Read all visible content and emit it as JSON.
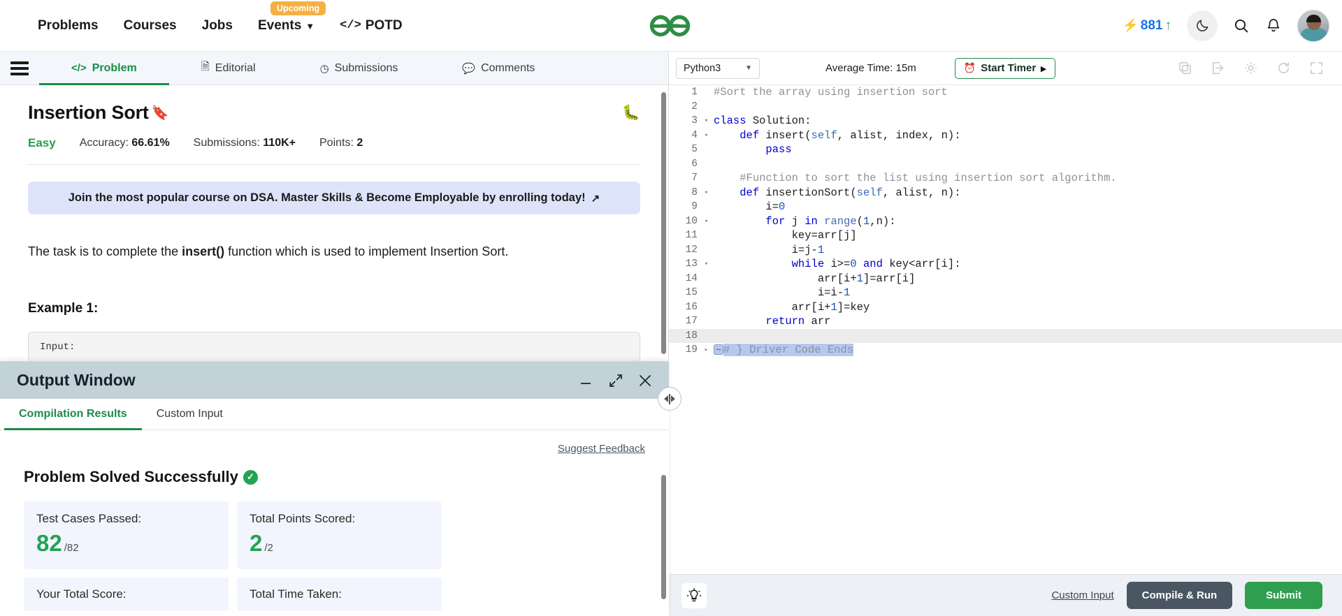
{
  "header": {
    "nav": [
      {
        "label": "Problems",
        "badge": null,
        "caret": false
      },
      {
        "label": "Courses",
        "badge": null,
        "caret": false
      },
      {
        "label": "Jobs",
        "badge": null,
        "caret": false
      },
      {
        "label": "Events",
        "badge": "Upcoming",
        "caret": true
      },
      {
        "label": "POTD",
        "badge": null,
        "caret": false
      }
    ],
    "logo_alt": "GeeksforGeeks",
    "streak_count": "881",
    "icons": [
      "bolt-icon",
      "arrow-up-icon",
      "moon-icon",
      "search-icon",
      "bell-icon",
      "avatar"
    ]
  },
  "left": {
    "tabs": [
      {
        "label": "Problem",
        "icon": "code-icon",
        "active": true
      },
      {
        "label": "Editorial",
        "icon": "document-icon",
        "active": false
      },
      {
        "label": "Submissions",
        "icon": "clock-icon",
        "active": false
      },
      {
        "label": "Comments",
        "icon": "comment-icon",
        "active": false
      }
    ],
    "problem_title": "Insertion Sort",
    "difficulty": "Easy",
    "accuracy_label": "Accuracy:",
    "accuracy_value": "66.61%",
    "submissions_label": "Submissions:",
    "submissions_value": "110K+",
    "points_label": "Points:",
    "points_value": "2",
    "promo_text": "Join the most popular course on DSA. Master Skills & Become Employable by enrolling today!",
    "description_pre": "The task is to complete the ",
    "description_bold": "insert()",
    "description_post": " function which is used to implement Insertion Sort.",
    "example_heading": "Example 1:",
    "example_body": "Input:"
  },
  "output_window": {
    "title": "Output Window",
    "window_buttons": [
      "minimize-icon",
      "maximize-icon",
      "close-icon"
    ],
    "tabs": [
      {
        "label": "Compilation Results",
        "active": true
      },
      {
        "label": "Custom Input",
        "active": false
      }
    ],
    "suggest_feedback": "Suggest Feedback",
    "status_text": "Problem Solved Successfully",
    "cards": [
      {
        "label": "Test Cases Passed:",
        "value": "82",
        "sub": "/82"
      },
      {
        "label": "Total Points Scored:",
        "value": "2",
        "sub": "/2"
      }
    ],
    "cards_slim": [
      {
        "label": "Your Total Score:"
      },
      {
        "label": "Total Time Taken:"
      }
    ]
  },
  "editor": {
    "language": "Python3",
    "average_time": "Average Time: 15m",
    "timer_button": "Start Timer",
    "tool_icons": [
      "copy-icon",
      "import-icon",
      "settings-icon",
      "reset-icon",
      "fullscreen-icon"
    ],
    "footer": {
      "bulb": "lightbulb-icon",
      "custom_input": "Custom Input",
      "compile_run": "Compile & Run",
      "submit": "Submit"
    },
    "lines": [
      {
        "n": "1",
        "fold": "",
        "html": "<span class='cm'>#Sort the array using insertion sort</span>"
      },
      {
        "n": "2",
        "fold": "",
        "html": ""
      },
      {
        "n": "3",
        "fold": "▾",
        "html": "<span class='kw'>class</span> Solution:"
      },
      {
        "n": "4",
        "fold": "▾",
        "html": "    <span class='kw'>def</span> insert(<span class='self'>self</span>, alist, index, n):"
      },
      {
        "n": "5",
        "fold": "",
        "html": "        <span class='kw'>pass</span>"
      },
      {
        "n": "6",
        "fold": "",
        "html": ""
      },
      {
        "n": "7",
        "fold": "",
        "html": "    <span class='cm'>#Function to sort the list using insertion sort algorithm.</span>"
      },
      {
        "n": "8",
        "fold": "▾",
        "html": "    <span class='kw'>def</span> insertionSort(<span class='self'>self</span>, alist, n):"
      },
      {
        "n": "9",
        "fold": "",
        "html": "        i=<span class='num'>0</span>"
      },
      {
        "n": "10",
        "fold": "▾",
        "html": "        <span class='kw'>for</span> j <span class='kw'>in</span> <span class='self'>range</span>(<span class='num'>1</span>,n):"
      },
      {
        "n": "11",
        "fold": "",
        "html": "            key=arr[j]"
      },
      {
        "n": "12",
        "fold": "",
        "html": "            i=j-<span class='num'>1</span>"
      },
      {
        "n": "13",
        "fold": "▾",
        "html": "            <span class='kw'>while</span> i&gt;=<span class='num'>0</span> <span class='kw'>and</span> key&lt;arr[i]:"
      },
      {
        "n": "14",
        "fold": "",
        "html": "                arr[i+<span class='num'>1</span>]=arr[i]"
      },
      {
        "n": "15",
        "fold": "",
        "html": "                i=i-<span class='num'>1</span>"
      },
      {
        "n": "16",
        "fold": "",
        "html": "            arr[i+<span class='num'>1</span>]=key"
      },
      {
        "n": "17",
        "fold": "",
        "html": "        <span class='kw'>return</span> arr"
      },
      {
        "n": "18",
        "fold": "",
        "html": "",
        "highlight": true
      },
      {
        "n": "19",
        "fold": "▸",
        "html": "<span class='foldwidget'>↔</span><span class='sel cm'># } Driver Code Ends</span>"
      }
    ]
  },
  "colors": {
    "green": "#2f9e4f",
    "accent_blue": "#1a73e8",
    "promo_bg": "#dde4fa",
    "output_header_bg": "#c3d1d8"
  }
}
